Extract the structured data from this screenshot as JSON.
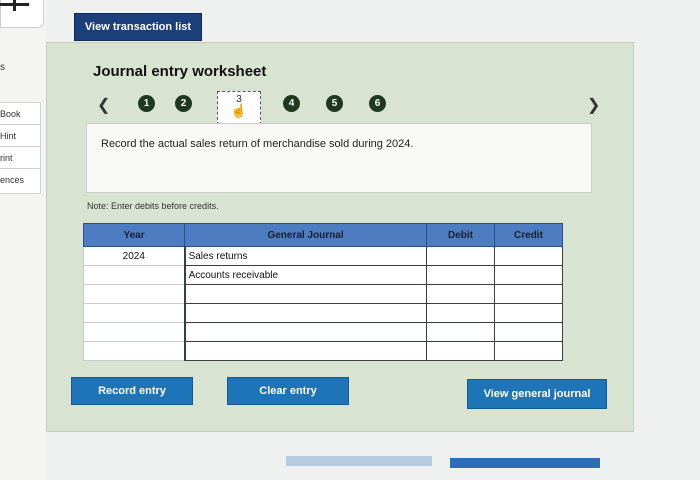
{
  "sidebar": {
    "items": [
      "Book",
      "Hint",
      "rint",
      "ences"
    ],
    "top_fragment": "s"
  },
  "header": {
    "view_transactions_label": "View transaction list"
  },
  "worksheet": {
    "title": "Journal entry worksheet",
    "steps": [
      "1",
      "2",
      "3",
      "4",
      "5",
      "6"
    ],
    "active_step": "3",
    "description": "Record the actual sales return of merchandise sold during 2024.",
    "note": "Note: Enter debits before credits."
  },
  "journal": {
    "headers": {
      "year": "Year",
      "account": "General Journal",
      "debit": "Debit",
      "credit": "Credit"
    },
    "rows": [
      {
        "year": "2024",
        "account": "Sales returns",
        "debit": "",
        "credit": ""
      },
      {
        "year": "",
        "account": "Accounts receivable",
        "debit": "",
        "credit": ""
      },
      {
        "year": "",
        "account": "",
        "debit": "",
        "credit": ""
      },
      {
        "year": "",
        "account": "",
        "debit": "",
        "credit": ""
      },
      {
        "year": "",
        "account": "",
        "debit": "",
        "credit": ""
      },
      {
        "year": "",
        "account": "",
        "debit": "",
        "credit": ""
      }
    ]
  },
  "buttons": {
    "record_entry": "Record entry",
    "clear_entry": "Clear entry",
    "view_general_journal": "View general journal"
  },
  "colors": {
    "primary_button": "#1d74b7",
    "dark_button": "#1b3f7a",
    "table_header": "#4e7cc0",
    "panel": "#d9e3d2"
  }
}
